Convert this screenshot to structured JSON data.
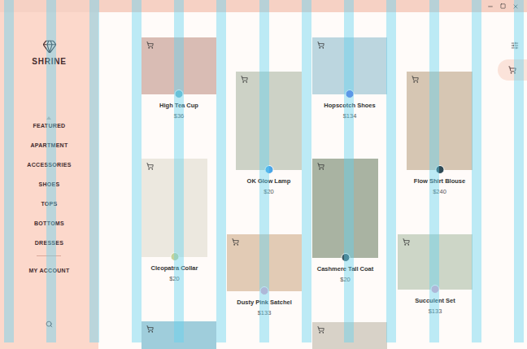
{
  "brand": {
    "name": "SHRINE"
  },
  "nav": {
    "items": [
      {
        "label": "FEATURED",
        "selected": true
      },
      {
        "label": "APARTMENT",
        "selected": false
      },
      {
        "label": "ACCESSORIES",
        "selected": false
      },
      {
        "label": "SHOES",
        "selected": false
      },
      {
        "label": "TOPS",
        "selected": false
      },
      {
        "label": "BOTTOMS",
        "selected": false
      },
      {
        "label": "DRESSES",
        "selected": false
      }
    ]
  },
  "account": {
    "label": "MY ACCOUNT"
  },
  "layout_grid": {
    "visible": true
  },
  "product_columns": [
    {
      "items": [
        {
          "kind": "product",
          "name": "High Tea Cup",
          "price": "$36"
        },
        {
          "kind": "product",
          "name": "Cleopatra Collar",
          "price": "$20"
        },
        {
          "kind": "photo"
        }
      ]
    },
    {
      "items": [
        {
          "kind": "product",
          "name": "OK Glow Lamp",
          "price": "$20"
        },
        {
          "kind": "product",
          "name": "Dusty Pink Satchel",
          "price": "$133"
        }
      ]
    },
    {
      "items": [
        {
          "kind": "product",
          "name": "Hopscotch Shoes",
          "price": "$134"
        },
        {
          "kind": "product",
          "name": "Cashmere Tall Coat",
          "price": "$20"
        },
        {
          "kind": "photo"
        }
      ]
    },
    {
      "items": [
        {
          "kind": "product",
          "name": "Flow Shirt Blouse",
          "price": "$240"
        },
        {
          "kind": "product",
          "name": "Succulent Set",
          "price": "$133"
        }
      ]
    }
  ]
}
